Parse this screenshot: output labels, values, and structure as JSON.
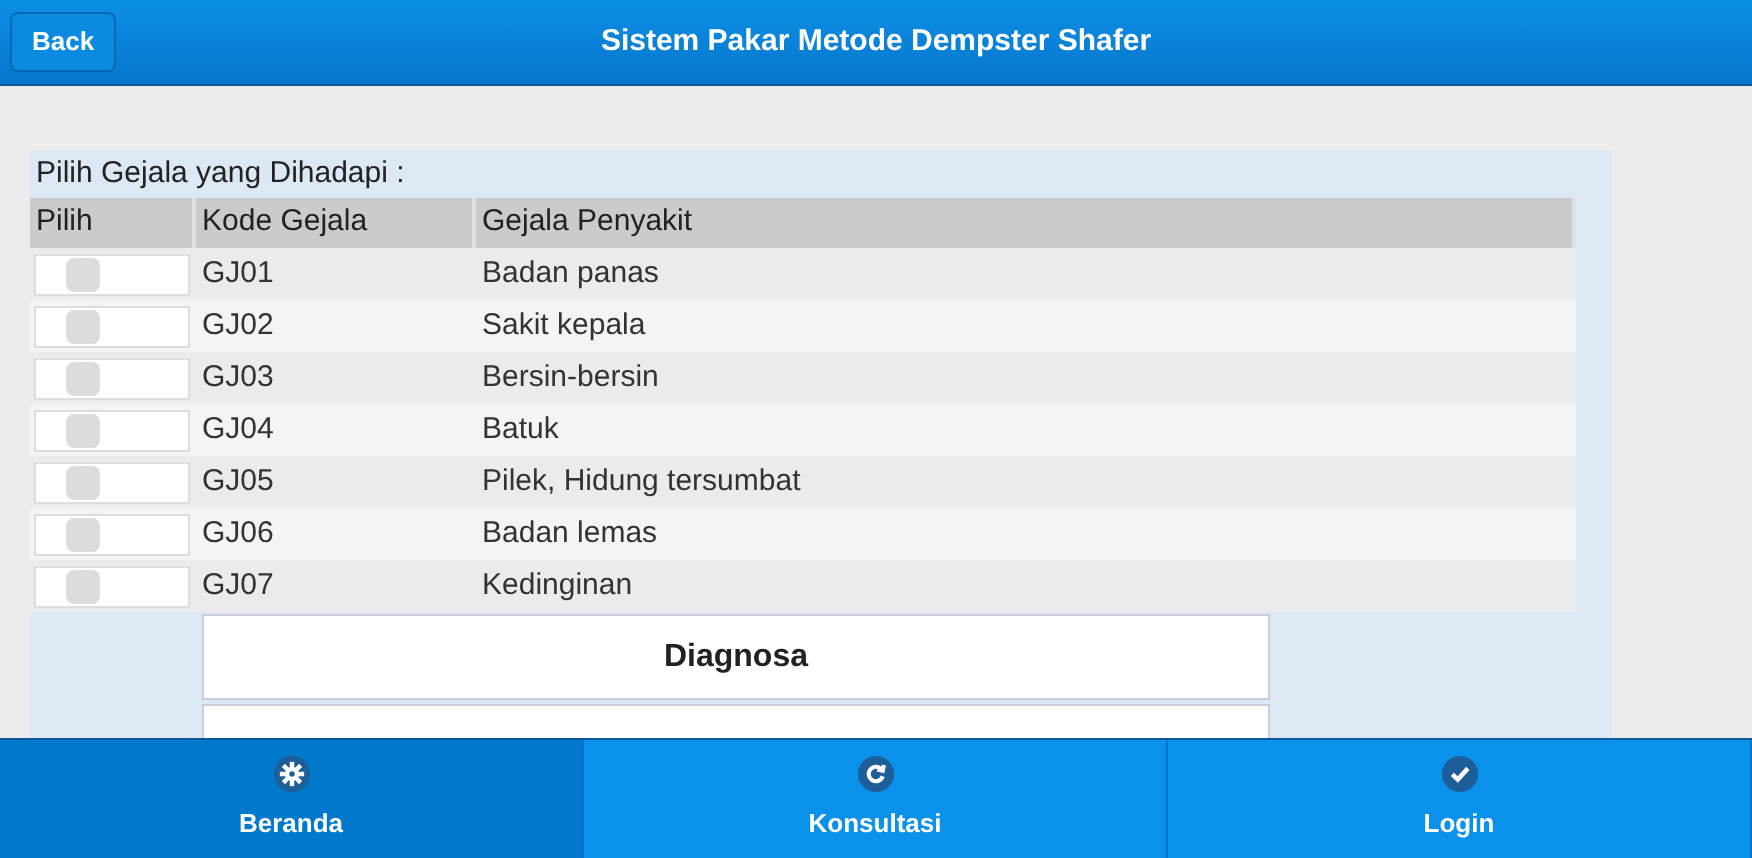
{
  "header": {
    "back_button": "Back",
    "title": "Sistem Pakar Metode Dempster Shafer"
  },
  "form": {
    "caption": "Pilih Gejala yang Dihadapi :",
    "columns": [
      "Pilih",
      "Kode Gejala",
      "Gejala Penyakit"
    ],
    "rows": [
      {
        "code": "GJ01",
        "symptom": "Badan panas",
        "checked": false
      },
      {
        "code": "GJ02",
        "symptom": "Sakit kepala",
        "checked": false
      },
      {
        "code": "GJ03",
        "symptom": "Bersin-bersin",
        "checked": false
      },
      {
        "code": "GJ04",
        "symptom": "Batuk",
        "checked": false
      },
      {
        "code": "GJ05",
        "symptom": "Pilek, Hidung tersumbat",
        "checked": false
      },
      {
        "code": "GJ06",
        "symptom": "Badan lemas",
        "checked": false
      },
      {
        "code": "GJ07",
        "symptom": "Kedinginan",
        "checked": false
      }
    ],
    "submit_button": "Diagnosa"
  },
  "nav": [
    {
      "label": "Beranda",
      "kind": "gear",
      "selected": true
    },
    {
      "label": "Konsultasi",
      "kind": "refresh",
      "selected": false
    },
    {
      "label": "Login",
      "kind": "check",
      "selected": false
    }
  ]
}
